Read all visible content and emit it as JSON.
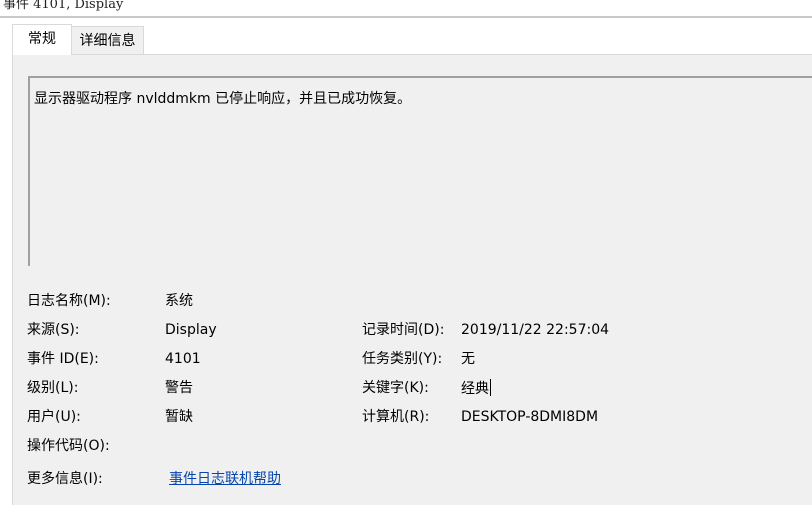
{
  "window": {
    "title": "事件 4101, Display"
  },
  "tabs": [
    {
      "label": "常规"
    },
    {
      "label": "详细信息"
    }
  ],
  "general": {
    "description": "显示器驱动程序 nvlddmkm 已停止响应，并且已成功恢复。",
    "fields": {
      "log_name": {
        "label": "日志名称(M):",
        "value": "系统"
      },
      "source": {
        "label": "来源(S):",
        "value": "Display"
      },
      "event_id": {
        "label": "事件 ID(E):",
        "value": "4101"
      },
      "level": {
        "label": "级别(L):",
        "value": "警告"
      },
      "user": {
        "label": "用户(U):",
        "value": "暂缺"
      },
      "opcode": {
        "label": "操作代码(O):",
        "value": ""
      },
      "more_info": {
        "label": "更多信息(I):",
        "value": "事件日志联机帮助"
      },
      "logged": {
        "label": "记录时间(D):",
        "value": "2019/11/22 22:57:04"
      },
      "task_category": {
        "label": "任务类别(Y):",
        "value": "无"
      },
      "keywords": {
        "label": "关键字(K):",
        "value": "经典"
      },
      "computer": {
        "label": "计算机(R):",
        "value": "DESKTOP-8DMI8DM"
      }
    }
  },
  "colors": {
    "link": "#0645ad",
    "panel_bg": "#f0f0f0"
  }
}
